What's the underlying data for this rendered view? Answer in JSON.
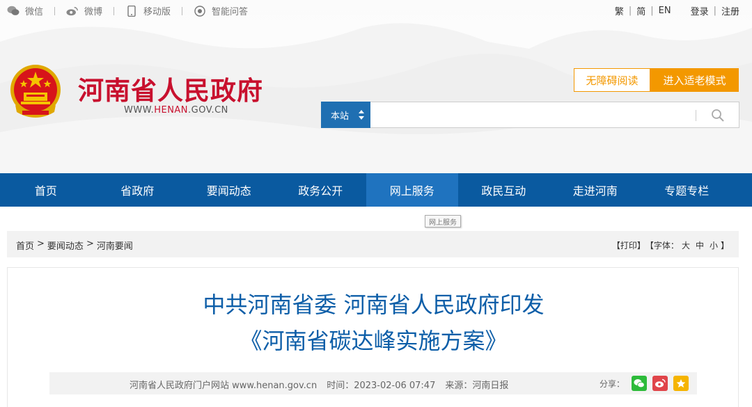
{
  "topbar": {
    "left_items": [
      {
        "label": "微信",
        "icon": "wechat-icon"
      },
      {
        "label": "微博",
        "icon": "weibo-icon"
      },
      {
        "label": "移动版",
        "icon": "mobile-icon"
      },
      {
        "label": "智能问答",
        "icon": "chat-icon"
      }
    ],
    "lang": {
      "traditional": "繁",
      "simplified": "简",
      "english": "EN"
    },
    "login": "登录",
    "register": "注册",
    "separator": "|"
  },
  "logo": {
    "title": "河南省人民政府",
    "url_prefix": "WWW.",
    "url_brand": "HENAN",
    "url_suffix": ".GOV.CN"
  },
  "access": {
    "accessible_label": "无障碍阅读",
    "elder_label": "进入适老模式"
  },
  "search": {
    "scope_label": "本站",
    "value": ""
  },
  "nav": {
    "items": [
      "首页",
      "省政府",
      "要闻动态",
      "政务公开",
      "网上服务",
      "政民互动",
      "走进河南",
      "专题专栏"
    ],
    "active_index": 4,
    "tooltip": "网上服务"
  },
  "breadcrumb": {
    "items": [
      "首页",
      "要闻动态",
      "河南要闻"
    ],
    "separator": ">",
    "print": "【打印】",
    "font_prefix": "【字体：",
    "font_large": "大",
    "font_medium": "中",
    "font_small": "小",
    "font_suffix": "】"
  },
  "article": {
    "title_line1": "中共河南省委 河南省人民政府印发",
    "title_line2": "《河南省碳达峰实施方案》",
    "source_site": "河南省人民政府门户网站 www.henan.gov.cn",
    "time": "时间：2023-02-06 07:47",
    "origin": "来源：河南日报",
    "share_label": "分享：",
    "share_icons": [
      "wechat-share-icon",
      "weibo-share-icon",
      "favorite-share-icon"
    ]
  },
  "colors": {
    "brand_red": "#c8102e",
    "nav_blue": "#0a5aa0",
    "nav_active": "#1f73bf",
    "title_blue": "#0d5ea8",
    "accent_orange": "#f39800"
  }
}
